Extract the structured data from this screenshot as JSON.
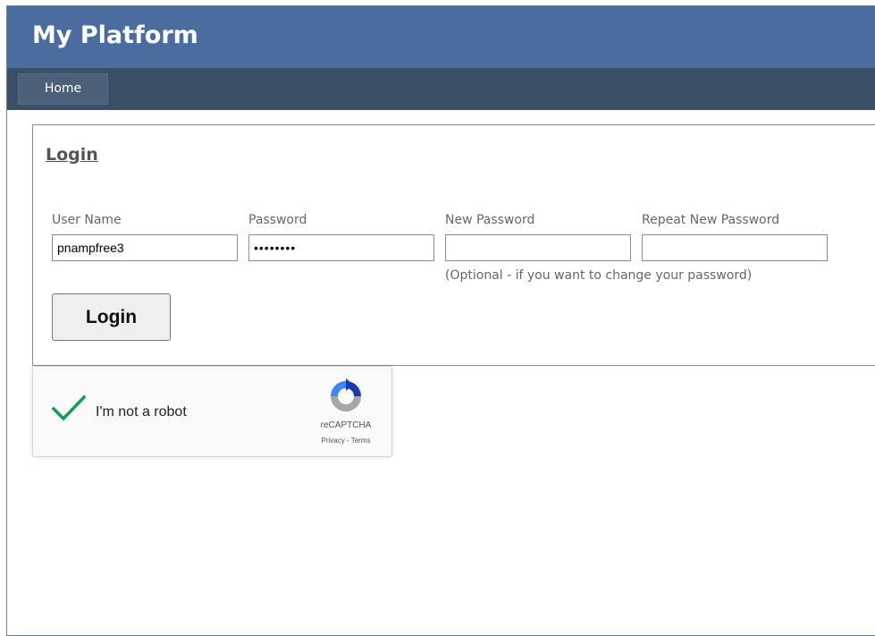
{
  "app": {
    "title": "My Platform"
  },
  "nav": {
    "items": [
      {
        "label": "Home"
      }
    ]
  },
  "login_panel": {
    "title": "Login",
    "fields": {
      "username": {
        "label": "User Name",
        "value": "pnampfree3"
      },
      "password": {
        "label": "Password",
        "value": "••••••••"
      },
      "new_password": {
        "label": "New Password",
        "value": ""
      },
      "repeat_new_password": {
        "label": "Repeat New Password",
        "value": ""
      }
    },
    "hint": "(Optional - if you want to change your password)",
    "login_button": "Login"
  },
  "captcha": {
    "label": "I'm not a robot",
    "brand": "reCAPTCHA",
    "privacy": "Privacy",
    "separator": " - ",
    "terms": "Terms",
    "checked": true,
    "check_color": "#0f9d58",
    "icons": [
      "check-icon",
      "recaptcha-logo-icon"
    ]
  },
  "colors": {
    "header_bg": "#4a6c9e",
    "navbar_bg": "#3b5067"
  }
}
